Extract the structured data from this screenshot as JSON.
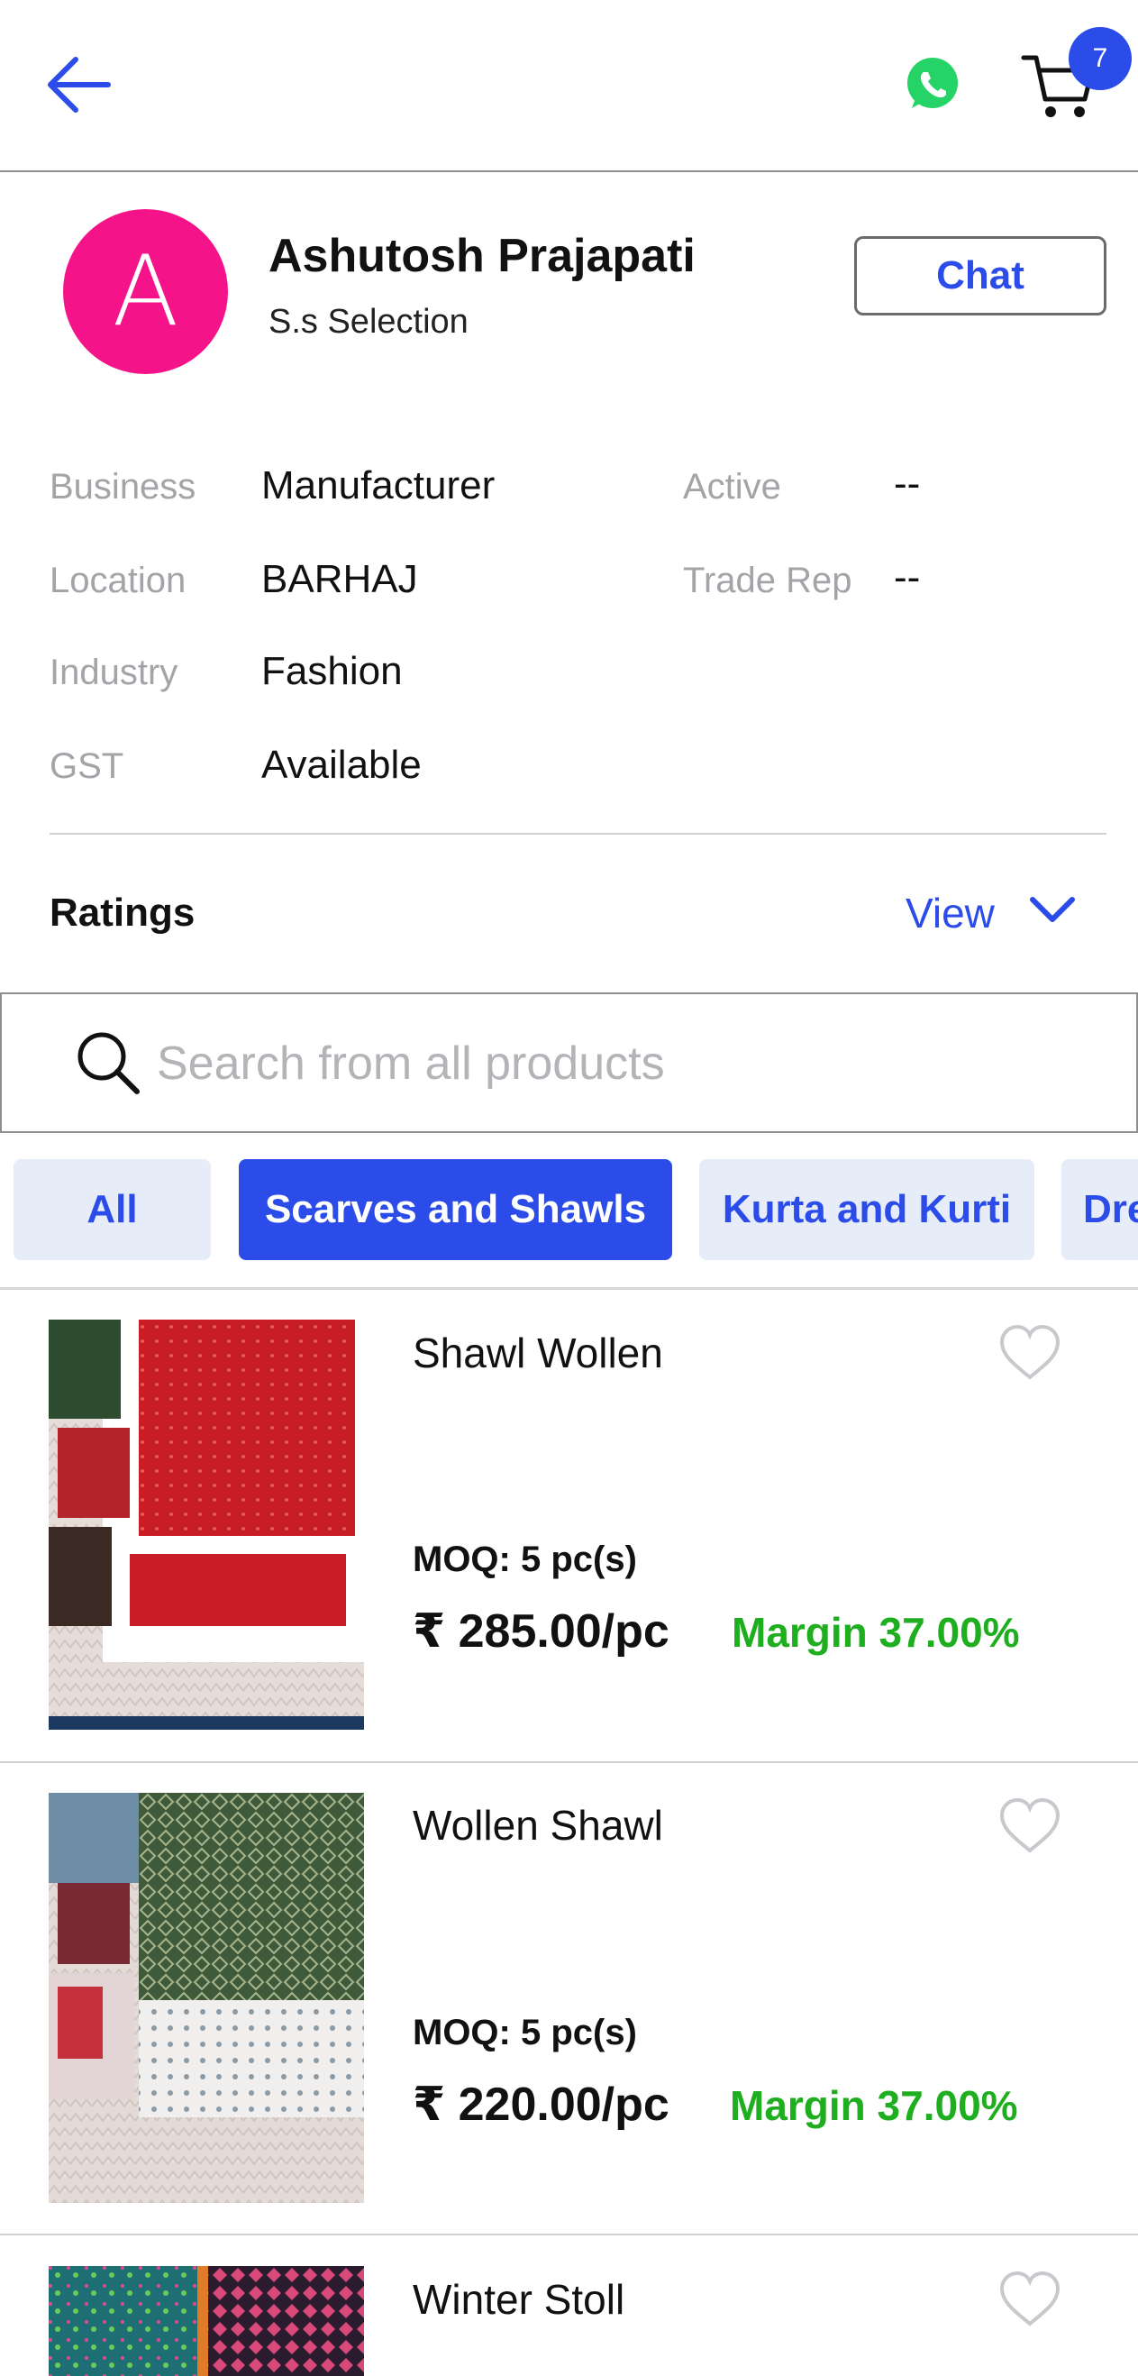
{
  "header": {
    "cart_count": "7"
  },
  "profile": {
    "avatar_letter": "A",
    "name": "Ashutosh Prajapati",
    "shop": "S.s Selection",
    "chat_label": "Chat"
  },
  "info": {
    "business_label": "Business",
    "business_value": "Manufacturer",
    "active_label": "Active",
    "active_value": "--",
    "location_label": "Location",
    "location_value": "BARHAJ",
    "trade_label": "Trade Rep",
    "trade_value": "--",
    "industry_label": "Industry",
    "industry_value": "Fashion",
    "gst_label": "GST",
    "gst_value": "Available"
  },
  "ratings": {
    "label": "Ratings",
    "view_label": "View"
  },
  "search": {
    "placeholder": "Search from all products"
  },
  "categories": [
    {
      "label": "All",
      "active": false
    },
    {
      "label": "Scarves and Shawls",
      "active": true
    },
    {
      "label": "Kurta and Kurti",
      "active": false
    },
    {
      "label": "Dre",
      "active": false
    }
  ],
  "products": [
    {
      "name": "Shawl Wollen",
      "moq": "MOQ: 5 pc(s)",
      "price": "₹ 285.00/pc",
      "margin": "Margin 37.00%"
    },
    {
      "name": "Wollen Shawl",
      "moq": "MOQ: 5 pc(s)",
      "price": "₹ 220.00/pc",
      "margin": "Margin 37.00%"
    },
    {
      "name": "Winter Stoll"
    }
  ],
  "colors": {
    "accent": "#2b4ce8",
    "avatar": "#f5138a",
    "margin_green": "#1fae1f",
    "whatsapp": "#25d366"
  },
  "icons": [
    "back-arrow-icon",
    "whatsapp-icon",
    "cart-icon",
    "chevron-down-icon",
    "search-icon",
    "heart-icon"
  ]
}
